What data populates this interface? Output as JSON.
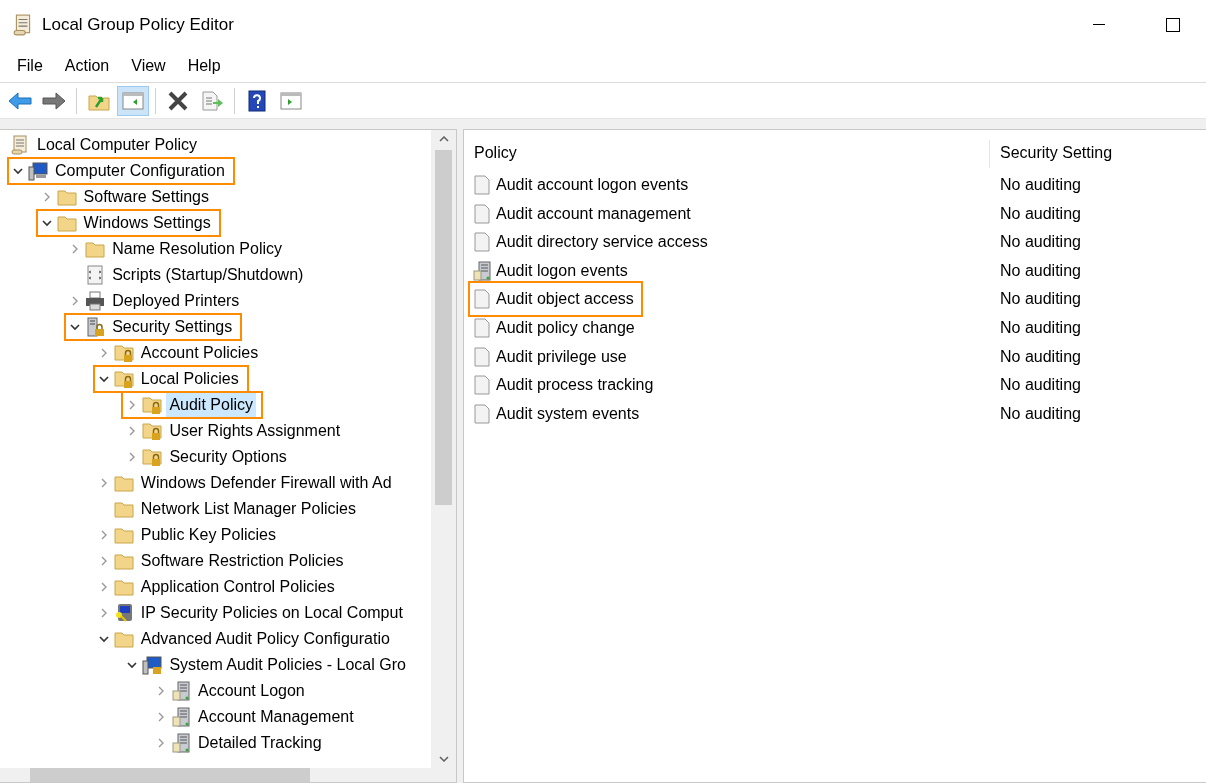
{
  "window": {
    "title": "Local Group Policy Editor"
  },
  "menu": [
    "File",
    "Action",
    "View",
    "Help"
  ],
  "toolbar": [
    {
      "kind": "back",
      "disabled": false
    },
    {
      "kind": "forward",
      "disabled": true
    },
    {
      "kind": "sep"
    },
    {
      "kind": "up",
      "selected": false
    },
    {
      "kind": "tree",
      "selected": true
    },
    {
      "kind": "sep"
    },
    {
      "kind": "delete",
      "selected": false
    },
    {
      "kind": "export",
      "selected": false
    },
    {
      "kind": "sep"
    },
    {
      "kind": "help",
      "selected": false
    },
    {
      "kind": "pane",
      "selected": false
    }
  ],
  "tree": [
    {
      "label": "Local Computer Policy",
      "kind": "scroll",
      "selected": false,
      "highlighted": false,
      "children": [
        {
          "label": "Computer Configuration",
          "kind": "computer",
          "expanded": true,
          "selected": false,
          "highlighted": true,
          "children": [
            {
              "label": "Software Settings",
              "kind": "folder",
              "expanded": false,
              "selected": false,
              "highlighted": false
            },
            {
              "label": "Windows Settings",
              "kind": "folder",
              "expanded": true,
              "selected": false,
              "highlighted": true,
              "children": [
                {
                  "label": "Name Resolution Policy",
                  "kind": "folder",
                  "expanded": false,
                  "selected": false,
                  "highlighted": false
                },
                {
                  "label": "Scripts (Startup/Shutdown)",
                  "kind": "script",
                  "selected": false,
                  "highlighted": false
                },
                {
                  "label": "Deployed Printers",
                  "kind": "printer",
                  "expanded": false,
                  "selected": false,
                  "highlighted": false
                },
                {
                  "label": "Security Settings",
                  "kind": "security",
                  "expanded": true,
                  "selected": false,
                  "highlighted": true,
                  "children": [
                    {
                      "label": "Account Policies",
                      "kind": "lockfolder",
                      "expanded": false,
                      "selected": false,
                      "highlighted": false
                    },
                    {
                      "label": "Local Policies",
                      "kind": "lockfolder",
                      "expanded": true,
                      "selected": false,
                      "highlighted": true,
                      "children": [
                        {
                          "label": "Audit Policy",
                          "kind": "lockfolder",
                          "expanded": false,
                          "selected": true,
                          "highlighted": true
                        },
                        {
                          "label": "User Rights Assignment",
                          "kind": "lockfolder",
                          "expanded": false,
                          "selected": false,
                          "highlighted": false
                        },
                        {
                          "label": "Security Options",
                          "kind": "lockfolder",
                          "expanded": false,
                          "selected": false,
                          "highlighted": false
                        }
                      ]
                    },
                    {
                      "label": "Windows Defender Firewall with Ad",
                      "kind": "folder",
                      "expanded": false,
                      "selected": false,
                      "highlighted": false
                    },
                    {
                      "label": "Network List Manager Policies",
                      "kind": "folder",
                      "selected": false,
                      "highlighted": false
                    },
                    {
                      "label": "Public Key Policies",
                      "kind": "folder",
                      "expanded": false,
                      "selected": false,
                      "highlighted": false
                    },
                    {
                      "label": "Software Restriction Policies",
                      "kind": "folder",
                      "expanded": false,
                      "selected": false,
                      "highlighted": false
                    },
                    {
                      "label": "Application Control Policies",
                      "kind": "folder",
                      "expanded": false,
                      "selected": false,
                      "highlighted": false
                    },
                    {
                      "label": "IP Security Policies on Local Comput",
                      "kind": "ipsec",
                      "expanded": false,
                      "selected": false,
                      "highlighted": false
                    },
                    {
                      "label": "Advanced Audit Policy Configuratio",
                      "kind": "folder",
                      "expanded": true,
                      "selected": false,
                      "highlighted": false,
                      "children": [
                        {
                          "label": "System Audit Policies - Local Gro",
                          "kind": "computerlock",
                          "expanded": true,
                          "selected": false,
                          "highlighted": false,
                          "children": [
                            {
                              "label": "Account Logon",
                              "kind": "server",
                              "expanded": false,
                              "selected": false,
                              "highlighted": false
                            },
                            {
                              "label": "Account Management",
                              "kind": "server",
                              "expanded": false,
                              "selected": false,
                              "highlighted": false
                            },
                            {
                              "label": "Detailed Tracking",
                              "kind": "server",
                              "expanded": false,
                              "selected": false,
                              "highlighted": false
                            }
                          ]
                        }
                      ]
                    }
                  ]
                }
              ]
            }
          ]
        }
      ]
    }
  ],
  "table": {
    "columns": [
      "Policy",
      "Security Setting"
    ],
    "rows": [
      {
        "policy": "Audit account logon events",
        "setting": "No auditing",
        "kind": "binary",
        "highlighted": false
      },
      {
        "policy": "Audit account management",
        "setting": "No auditing",
        "kind": "binary",
        "highlighted": false
      },
      {
        "policy": "Audit directory service access",
        "setting": "No auditing",
        "kind": "binary",
        "highlighted": false
      },
      {
        "policy": "Audit logon events",
        "setting": "No auditing",
        "kind": "server",
        "highlighted": false
      },
      {
        "policy": "Audit object access",
        "setting": "No auditing",
        "kind": "binary",
        "highlighted": true
      },
      {
        "policy": "Audit policy change",
        "setting": "No auditing",
        "kind": "binary",
        "highlighted": false
      },
      {
        "policy": "Audit privilege use",
        "setting": "No auditing",
        "kind": "binary",
        "highlighted": false
      },
      {
        "policy": "Audit process tracking",
        "setting": "No auditing",
        "kind": "binary",
        "highlighted": false
      },
      {
        "policy": "Audit system events",
        "setting": "No auditing",
        "kind": "binary",
        "highlighted": false
      }
    ]
  }
}
